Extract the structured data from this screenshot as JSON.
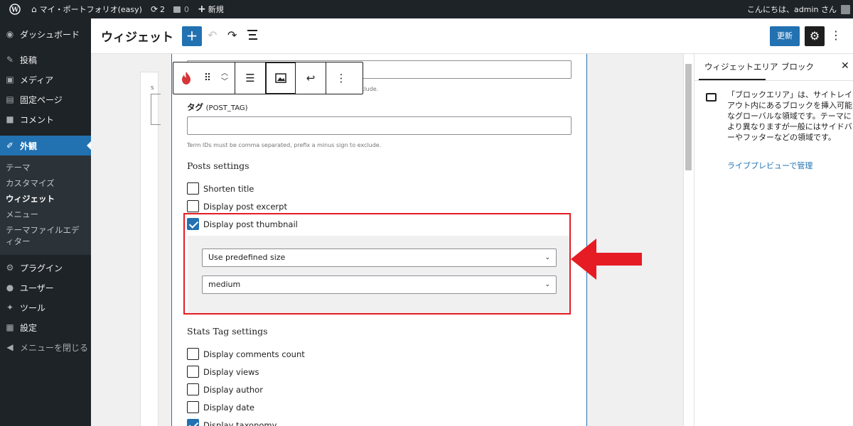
{
  "adminbar": {
    "site_name": "マイ・ポートフォリオ(easy)",
    "updates_count": "2",
    "comments_count": "0",
    "new_label": "新規",
    "greeting": "こんにちは、admin さん"
  },
  "menu": {
    "items_top": [
      {
        "label": "ダッシュボード",
        "icon": "dashboard-icon"
      },
      {
        "label": "投稿",
        "icon": "pin-icon"
      },
      {
        "label": "メディア",
        "icon": "media-icon"
      },
      {
        "label": "固定ページ",
        "icon": "page-icon"
      },
      {
        "label": "コメント",
        "icon": "comment-icon"
      }
    ],
    "current": {
      "label": "外観",
      "icon": "brush-icon"
    },
    "submenu": [
      "テーマ",
      "カスタマイズ",
      "ウィジェット",
      "メニュー",
      "テーマファイルエディター"
    ],
    "submenu_current": "ウィジェット",
    "items_bottom": [
      {
        "label": "プラグイン",
        "icon": "plugin-icon"
      },
      {
        "label": "ユーザー",
        "icon": "user-icon"
      },
      {
        "label": "ツール",
        "icon": "wrench-icon"
      },
      {
        "label": "設定",
        "icon": "settings-icon"
      }
    ],
    "collapse_label": "メニューを閉じる"
  },
  "header": {
    "title": "ウィジェット",
    "update_label": "更新"
  },
  "form": {
    "exclude_help_partial": "clude.",
    "tag_label": "タグ",
    "tag_label_suffix": "(POST_TAG)",
    "tag_help": "Term IDs must be comma separated, prefix a minus sign to exclude.",
    "posts_settings_heading": "Posts settings",
    "posts_options": [
      {
        "label": "Shorten title",
        "checked": false
      },
      {
        "label": "Display post excerpt",
        "checked": false
      },
      {
        "label": "Display post thumbnail",
        "checked": true
      }
    ],
    "thumb_size_mode": "Use predefined size",
    "thumb_size": "medium",
    "stats_heading": "Stats Tag settings",
    "stats_options": [
      {
        "label": "Display comments count",
        "checked": false
      },
      {
        "label": "Display views",
        "checked": false
      },
      {
        "label": "Display author",
        "checked": false
      },
      {
        "label": "Display date",
        "checked": false
      },
      {
        "label": "Display taxonomy",
        "checked": true
      }
    ]
  },
  "sidebar": {
    "tab_area": "ウィジェットエリア",
    "tab_block": "ブロック",
    "description": "「ブロックエリア」は、サイトレイアウト内にあるブロックを挿入可能なグローバルな領域です。テーマにより異なりますが一般にはサイドバーやフッターなどの領域です。",
    "link_label": "ライブプレビューで管理"
  },
  "colors": {
    "admin_dark": "#1d2327",
    "accent": "#2271b1",
    "highlight_red": "#e51c23"
  }
}
